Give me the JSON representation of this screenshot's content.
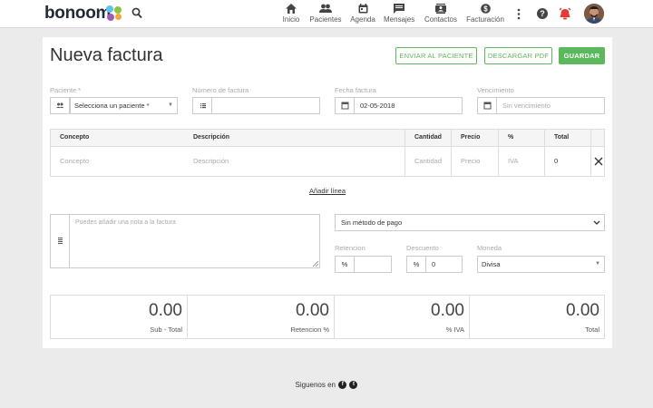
{
  "app": {
    "logo": "bonoom",
    "brand_dot_colors": [
      "#5bc4e8",
      "#8cc63f",
      "#a05db4",
      "#f2a93b"
    ]
  },
  "nav": [
    {
      "label": "Inicio",
      "icon": "home-icon"
    },
    {
      "label": "Pacientes",
      "icon": "users-icon"
    },
    {
      "label": "Agenda",
      "icon": "calendar-icon"
    },
    {
      "label": "Mensajes",
      "icon": "chat-icon"
    },
    {
      "label": "Contactos",
      "icon": "contacts-icon"
    },
    {
      "label": "Facturación",
      "icon": "dollar-icon"
    }
  ],
  "page": {
    "title": "Nueva factura",
    "buttons": {
      "send": "ENVIAR AL PACIENTE",
      "download": "DESCARGAR PDF",
      "save": "GUARDAR"
    }
  },
  "form": {
    "patient": {
      "label": "Paciente *",
      "value": "Selecciona un paciente *"
    },
    "invoice_number": {
      "label": "Número de factura",
      "value": ""
    },
    "invoice_date": {
      "label": "Fecha factura",
      "value": "02-05-2018"
    },
    "due_date": {
      "label": "Vencimiento",
      "placeholder": "Sin vencimiento"
    }
  },
  "table": {
    "headers": [
      "Concepto",
      "Descripción",
      "Cantidad",
      "Precio",
      "%",
      "Total"
    ],
    "row": {
      "concept": "Concepto",
      "description": "Descripción",
      "quantity": "Cantidad",
      "price": "Precio",
      "tax": "IVA",
      "total": "0"
    },
    "add_line": "Añadir línea"
  },
  "note": {
    "placeholder": "Puedes añadir una nota a la factura"
  },
  "payment": {
    "method": "Sin método de pago",
    "retention_label": "Retencion",
    "retention_unit": "%",
    "retention_value": "",
    "discount_label": "Descuento",
    "discount_unit": "%",
    "discount_value": "0",
    "currency_label": "Moneda",
    "currency_value": "Divisa"
  },
  "totals": [
    {
      "value": "0.00",
      "label": "Sub - Total"
    },
    {
      "value": "0.00",
      "label": "Retencion %"
    },
    {
      "value": "0.00",
      "label": "% IVA"
    },
    {
      "value": "0.00",
      "label": "Total"
    }
  ],
  "footer": {
    "text": "Siguenos en"
  },
  "colors": {
    "accent": "#5cb85c",
    "alarm": "#e53935"
  }
}
